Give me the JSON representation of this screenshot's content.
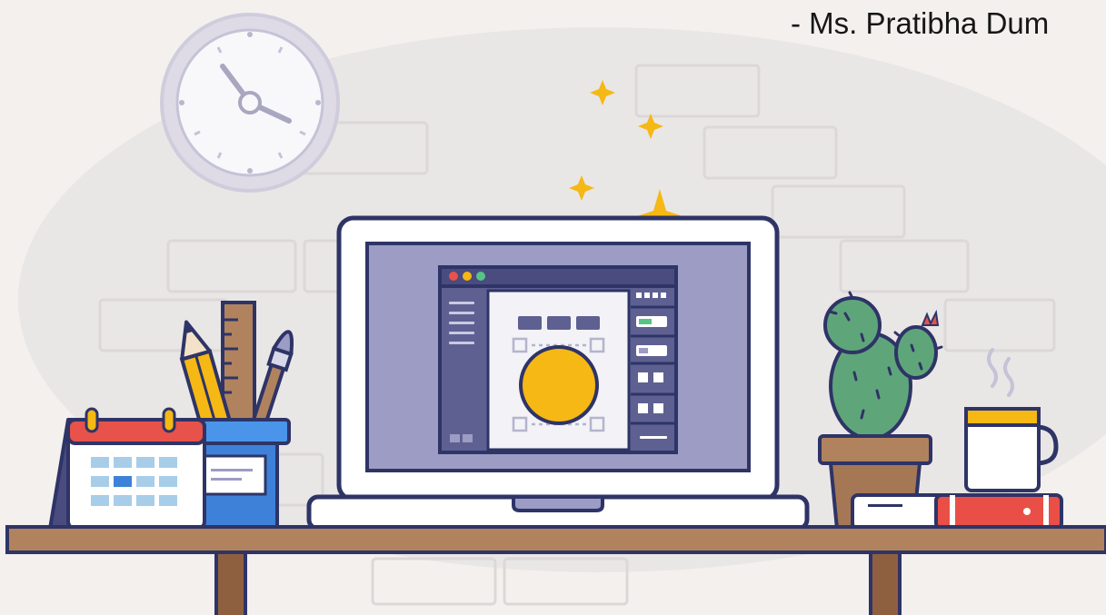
{
  "caption": {
    "author_credit": "- Ms. Pratibha Dum"
  },
  "colors": {
    "background": "#f3f0ee",
    "blob": "#e9e6e6",
    "outline": "#2e3466",
    "screen": "#9c9cc4",
    "accent_yellow": "#f5b814",
    "desk": "#b0835e",
    "cactus": "#5fa57a",
    "pot": "#a57755",
    "book_red": "#ea4f47",
    "cup_blue": "#3d82d8"
  },
  "illustration": {
    "subject": "workspace-desk",
    "objects": [
      "wall-clock",
      "laptop",
      "design-app-window",
      "sparkles",
      "desk-calendar",
      "pencil-cup",
      "cactus-plant",
      "book-stack",
      "coffee-mug",
      "desk"
    ]
  }
}
